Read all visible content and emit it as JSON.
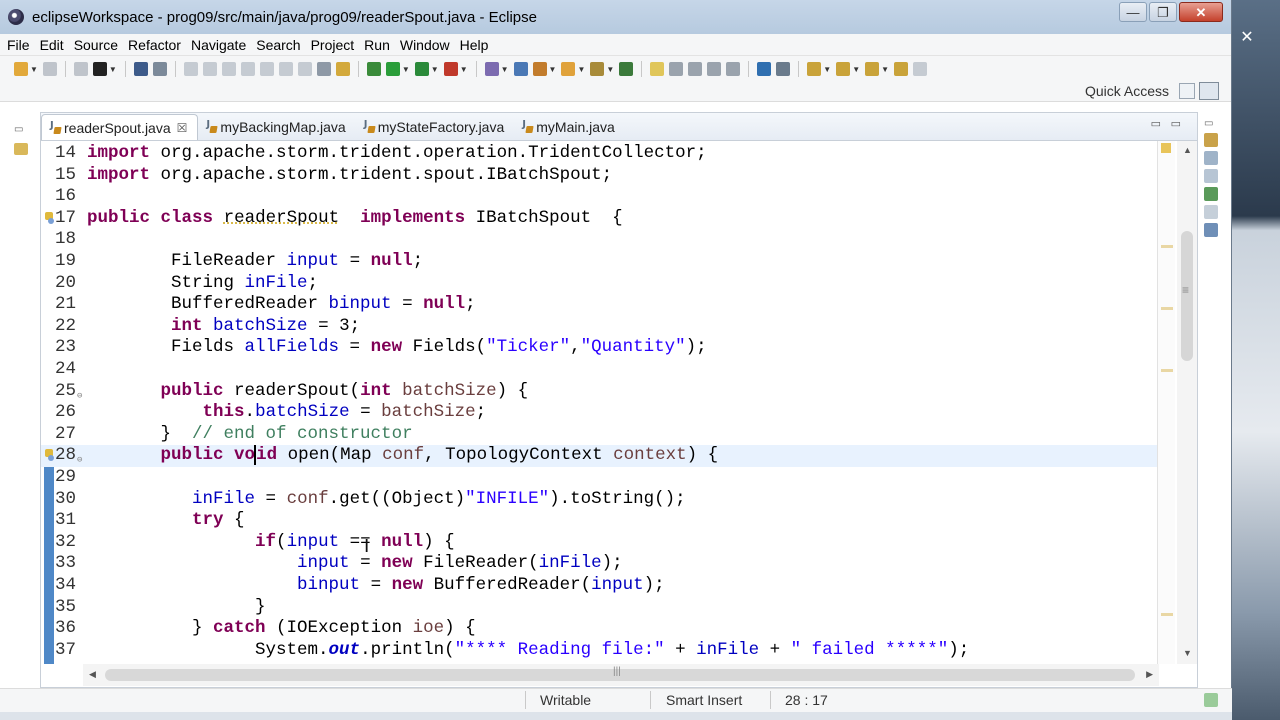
{
  "window": {
    "title": "eclipseWorkspace - prog09/src/main/java/prog09/readerSpout.java - Eclipse",
    "controls": {
      "minimize": "—",
      "maximize": "❐",
      "close": "✕"
    }
  },
  "desktop": {
    "close_glyph": "✕"
  },
  "menu": [
    "File",
    "Edit",
    "Source",
    "Refactor",
    "Navigate",
    "Search",
    "Project",
    "Run",
    "Window",
    "Help"
  ],
  "toolbar": {
    "quick_access": "Quick Access",
    "icons": [
      {
        "name": "new-icon",
        "color": "#e2a93b"
      },
      {
        "name": "save-icon",
        "color": "#bfc4cb"
      },
      {
        "name": "save-all-icon",
        "color": "#bfc4cb"
      },
      {
        "name": "github-icon",
        "color": "#222222"
      },
      {
        "name": "terminal-icon",
        "color": "#3d5b8a"
      },
      {
        "name": "skip-breakpoints-icon",
        "color": "#7c8a9a"
      },
      {
        "name": "resume-icon",
        "color": "#c5cbd2"
      },
      {
        "name": "suspend-icon",
        "color": "#c5cbd2"
      },
      {
        "name": "terminate-icon",
        "color": "#c5cbd2"
      },
      {
        "name": "disconnect-icon",
        "color": "#c5cbd2"
      },
      {
        "name": "step-into-icon",
        "color": "#c5cbd2"
      },
      {
        "name": "step-over-icon",
        "color": "#c5cbd2"
      },
      {
        "name": "step-return-icon",
        "color": "#c5cbd2"
      },
      {
        "name": "drop-to-frame-icon",
        "color": "#8e99a6"
      },
      {
        "name": "use-step-filters-icon",
        "color": "#d3a93c"
      },
      {
        "name": "debug-icon",
        "color": "#3a8b3a"
      },
      {
        "name": "run-icon",
        "color": "#2a9d3a"
      },
      {
        "name": "coverage-icon",
        "color": "#2a8a3a"
      },
      {
        "name": "external-tools-icon",
        "color": "#c0392b"
      },
      {
        "name": "new-java-project-icon",
        "color": "#7c6bb0"
      },
      {
        "name": "new-package-icon",
        "color": "#4a78b5"
      },
      {
        "name": "open-type-icon",
        "color": "#c27c2c"
      },
      {
        "name": "open-task-icon",
        "color": "#e0a23b"
      },
      {
        "name": "search-icon",
        "color": "#a88b3a"
      },
      {
        "name": "annotation-icon",
        "color": "#3b7a3b"
      },
      {
        "name": "toggle-mark-occurrences-icon",
        "color": "#e0c65a"
      },
      {
        "name": "toggle-block-selection-icon",
        "color": "#9aa3ad"
      },
      {
        "name": "show-whitespace-icon",
        "color": "#9aa3ad"
      },
      {
        "name": "show-javadoc-icon",
        "color": "#9aa3ad"
      },
      {
        "name": "pilcrow-icon",
        "color": "#9aa3ad"
      },
      {
        "name": "globe-icon",
        "color": "#2f6fb0"
      },
      {
        "name": "pin-icon",
        "color": "#6a7b8c"
      },
      {
        "name": "next-annotation-icon",
        "color": "#c9a33a"
      },
      {
        "name": "prev-annotation-icon",
        "color": "#c9a33a"
      },
      {
        "name": "last-edit-icon",
        "color": "#c9a33a"
      },
      {
        "name": "back-icon",
        "color": "#c9a33a"
      },
      {
        "name": "forward-icon",
        "color": "#c5cbd2"
      }
    ]
  },
  "tabs": [
    {
      "label": "readerSpout.java",
      "active": true,
      "close": "☒"
    },
    {
      "label": "myBackingMap.java",
      "active": false
    },
    {
      "label": "myStateFactory.java",
      "active": false
    },
    {
      "label": "myMain.java",
      "active": false
    }
  ],
  "tab_controls": {
    "minimize": "▭",
    "maximize": "▭"
  },
  "code_lines": [
    {
      "n": "14",
      "html": "<span class=\"kw\">import</span> org.apache.storm.trident.operation.TridentCollector;"
    },
    {
      "n": "15",
      "html": "<span class=\"kw\">import</span> org.apache.storm.trident.spout.IBatchSpout;"
    },
    {
      "n": "16",
      "html": ""
    },
    {
      "n": "17",
      "html": "<span class=\"kw\">public</span> <span class=\"kw\">class</span> <u style=\"text-decoration-color:#d4b030;text-decoration-style:dotted\">readerSpout</u>  <span class=\"kw\">implements</span> IBatchSpout  {",
      "marker": true
    },
    {
      "n": "18",
      "html": ""
    },
    {
      "n": "19",
      "html": "        FileReader <span class=\"fld\">input</span> = <span class=\"kw\">null</span>;"
    },
    {
      "n": "20",
      "html": "        String <span class=\"fld\">inFile</span>;"
    },
    {
      "n": "21",
      "html": "        BufferedReader <span class=\"fld\">binput</span> = <span class=\"kw\">null</span>;"
    },
    {
      "n": "22",
      "html": "        <span class=\"kw\">int</span> <span class=\"fld\">batchSize</span> = 3;"
    },
    {
      "n": "23",
      "html": "        Fields <span class=\"fld\">allFields</span> = <span class=\"kw\">new</span> Fields(<span class=\"str\">\"Ticker\"</span>,<span class=\"str\">\"Quantity\"</span>);"
    },
    {
      "n": "24",
      "html": ""
    },
    {
      "n": "25",
      "html": "       <span class=\"kw\">public</span> readerSpout(<span class=\"kw\">int</span> <span class=\"var\">batchSize</span>) {",
      "fold": true
    },
    {
      "n": "26",
      "html": "           <span class=\"kw\">this</span>.<span class=\"fld\">batchSize</span> = <span class=\"var\">batchSize</span>;"
    },
    {
      "n": "27",
      "html": "       }  <span class=\"cmt\">// end of constructor</span>"
    },
    {
      "n": "28",
      "html": "       <span class=\"kw\">public</span> <span class=\"kw\">vo<span style=\"border-left:2px solid #000;margin-left:-1px\"></span>id</span> open(Map <span class=\"var\">conf</span>, TopologyContext <span class=\"var\">context</span>) {",
      "current": true,
      "marker": true,
      "fold": true
    },
    {
      "n": "29",
      "html": ""
    },
    {
      "n": "30",
      "html": "          <span class=\"fld\">inFile</span> = <span class=\"var\">conf</span>.get((Object)<span class=\"str\">\"INFILE\"</span>).toString();"
    },
    {
      "n": "31",
      "html": "          <span class=\"kw\">try</span> {"
    },
    {
      "n": "32",
      "html": "                <span class=\"kw\">if</span>(<span class=\"fld\">input</span> == <span class=\"kw\">null</span>) {"
    },
    {
      "n": "33",
      "html": "                    <span class=\"fld\">input</span> = <span class=\"kw\">new</span> FileReader(<span class=\"fld\">inFile</span>);"
    },
    {
      "n": "34",
      "html": "                    <span class=\"fld\">binput</span> = <span class=\"kw\">new</span> BufferedReader(<span class=\"fld\">input</span>);"
    },
    {
      "n": "35",
      "html": "                }"
    },
    {
      "n": "36",
      "html": "          } <span class=\"kw\">catch</span> (IOException <span class=\"var\">ioe</span>) {"
    },
    {
      "n": "37",
      "html": "                System.<b><i class=\"fld\">out</i></b>.println(<span class=\"str\">\"**** Reading file:\"</span> + <span class=\"fld\">inFile</span> + <span class=\"str\">\" failed *****\"</span>);"
    }
  ],
  "status": {
    "writable": "Writable",
    "insert_mode": "Smart Insert",
    "position": "28 : 17"
  }
}
